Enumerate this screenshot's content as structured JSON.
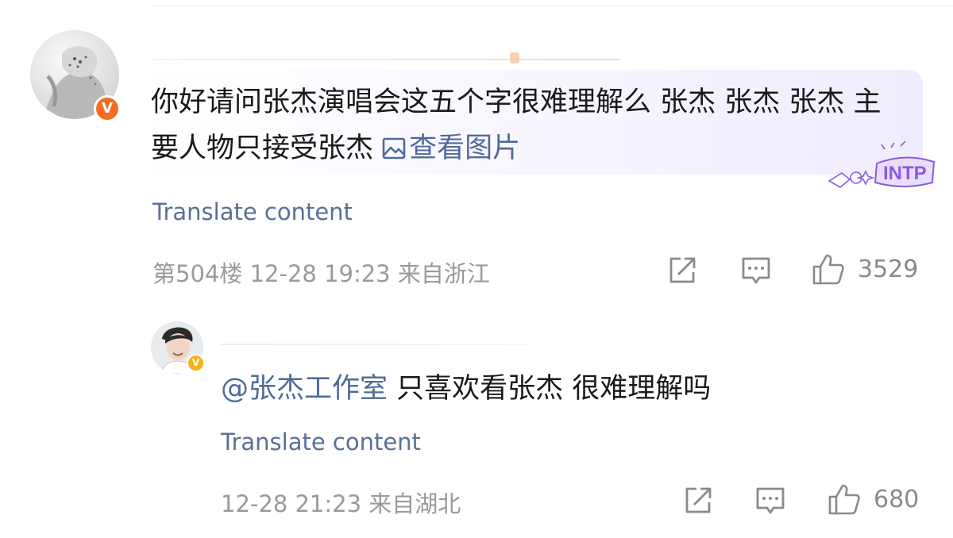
{
  "main_comment": {
    "text": "你好请问张杰演唱会这五个字很难理解么 张杰 张杰 张杰 主要人物只接受张杰",
    "image_link_label": "查看图片",
    "translate_label": "Translate content",
    "floor": "第504楼",
    "time": "12-28 19:23",
    "location": "来自浙江",
    "like_count": "3529",
    "verified_badge": "V",
    "sticker_text": "INTP"
  },
  "reply": {
    "mention": "@张杰工作室",
    "text": " 只喜欢看张杰 很难理解吗",
    "translate_label": "Translate content",
    "time": "12-28 21:23",
    "location": "来自湖北",
    "like_count": "680",
    "verified_badge": "V"
  },
  "icons": {
    "share": "share-icon",
    "comment": "comment-icon",
    "like": "thumbs-up-icon",
    "image": "image-icon"
  },
  "colors": {
    "link": "#506a9a",
    "badge_main": "#f36f1f",
    "badge_reply": "#f4b21b",
    "sticker": "#8a5be0"
  }
}
